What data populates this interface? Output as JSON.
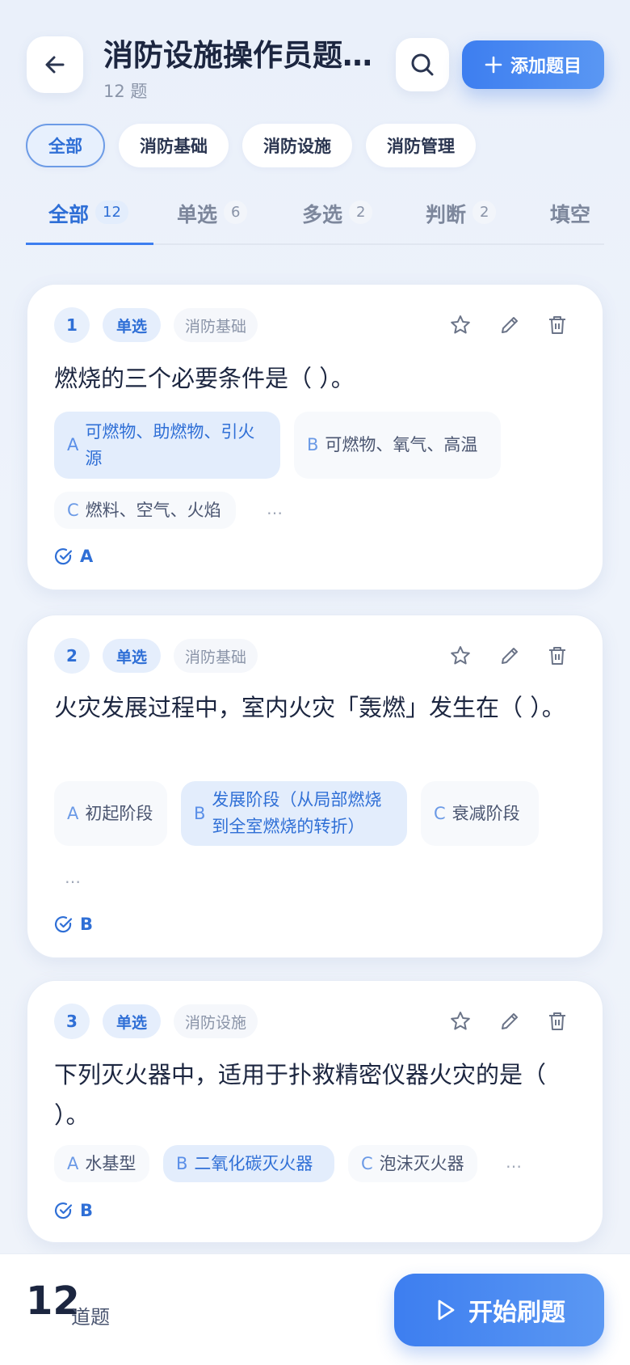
{
  "header": {
    "title": "消防设施操作员题…",
    "subtitle": "12 题",
    "add_button_label": "添加题目"
  },
  "filter_chips": [
    {
      "label": "全部",
      "active": true
    },
    {
      "label": "消防基础",
      "active": false
    },
    {
      "label": "消防设施",
      "active": false
    },
    {
      "label": "消防管理",
      "active": false
    }
  ],
  "tabs": [
    {
      "label": "全部",
      "count": "12",
      "active": true
    },
    {
      "label": "单选",
      "count": "6",
      "active": false
    },
    {
      "label": "多选",
      "count": "2",
      "active": false
    },
    {
      "label": "判断",
      "count": "2",
      "active": false
    },
    {
      "label": "填空",
      "count": "",
      "active": false
    }
  ],
  "questions": [
    {
      "number": "1",
      "type": "单选",
      "category": "消防基础",
      "text": "燃烧的三个必要条件是（ ）。",
      "options": [
        {
          "key": "A",
          "text": "可燃物、助燃物、引火源",
          "correct": true
        },
        {
          "key": "B",
          "text": "可燃物、氧气、高温",
          "correct": false
        },
        {
          "key": "C",
          "text": "燃料、空气、火焰",
          "correct": false
        }
      ],
      "more": "…",
      "answer": "A"
    },
    {
      "number": "2",
      "type": "单选",
      "category": "消防基础",
      "text": "火灾发展过程中，室内火灾「轰燃」发生在（ ）。",
      "options": [
        {
          "key": "A",
          "text": "初起阶段",
          "correct": false
        },
        {
          "key": "B",
          "text": "发展阶段（从局部燃烧到全室燃烧的转折）",
          "correct": true
        },
        {
          "key": "C",
          "text": "衰减阶段",
          "correct": false
        }
      ],
      "more": "…",
      "answer": "B"
    },
    {
      "number": "3",
      "type": "单选",
      "category": "消防设施",
      "text": "下列灭火器中，适用于扑救精密仪器火灾的是（ ）。",
      "options": [
        {
          "key": "A",
          "text": "水基型",
          "correct": false
        },
        {
          "key": "B",
          "text": "二氧化碳灭火器",
          "correct": true
        },
        {
          "key": "C",
          "text": "泡沫灭火器",
          "correct": false
        }
      ],
      "more": "…",
      "answer": "B"
    }
  ],
  "footer": {
    "total": "12",
    "unit": "道题",
    "start_label": "开始刷题"
  },
  "colors": {
    "accent": "#3d7ef0",
    "accent_text": "#2f6fd6",
    "background": "#eef3fb"
  }
}
